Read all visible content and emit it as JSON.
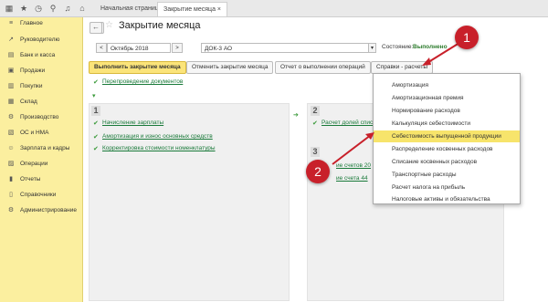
{
  "topbar": {
    "tabs": [
      "Начальная страница",
      "Закрытие месяца"
    ],
    "close_glyph": "×"
  },
  "sidebar": {
    "items": [
      {
        "label": "Главное",
        "icon": "menu-icon"
      },
      {
        "label": "Руководителю",
        "icon": "chart-icon"
      },
      {
        "label": "Банк и касса",
        "icon": "bank-icon"
      },
      {
        "label": "Продажи",
        "icon": "sales-icon"
      },
      {
        "label": "Покупки",
        "icon": "purchases-icon"
      },
      {
        "label": "Склад",
        "icon": "warehouse-icon"
      },
      {
        "label": "Производство",
        "icon": "production-icon"
      },
      {
        "label": "ОС и НМА",
        "icon": "assets-icon"
      },
      {
        "label": "Зарплата и кадры",
        "icon": "salary-icon"
      },
      {
        "label": "Операции",
        "icon": "operations-icon"
      },
      {
        "label": "Отчеты",
        "icon": "reports-icon"
      },
      {
        "label": "Справочники",
        "icon": "catalogs-icon"
      },
      {
        "label": "Администрирование",
        "icon": "admin-icon"
      }
    ]
  },
  "header": {
    "title": "Закрытие месяца"
  },
  "filters": {
    "period": "Октябрь 2018",
    "organization": "ДОК-3 АО",
    "state_label": "Состояние:",
    "state_value": "Выполнено"
  },
  "toolbar": {
    "run": "Выполнить закрытие месяца",
    "cancel": "Отменить закрытие месяца",
    "report": "Отчет о выполнении операций",
    "references": "Справки - расчеты"
  },
  "steps": {
    "pre_link": "Перепроведение документов",
    "step1_num": "1",
    "step1_items": [
      "Начисление зарплаты",
      "Амортизация и износ основных средств",
      "Корректировка стоимости номенклатуры"
    ],
    "step2_num": "2",
    "step2_item": "Расчет долей списа",
    "step3_num": "3",
    "step3_items": [
      "ие счетов 20",
      "ие счета 44"
    ]
  },
  "dropdown": {
    "items": [
      "Амортизация",
      "Амортизационная премия",
      "Нормирование расходов",
      "Калькуляция себестоимости",
      "Себестоимость выпущенной продукции",
      "Распределение косвенных расходов",
      "Списание косвенных расходов",
      "Транспортные расходы",
      "Расчет налога на прибыль",
      "Налоговые активы и обязательства"
    ],
    "highlighted_index": 4
  },
  "callouts": [
    "1",
    "2"
  ],
  "colors": {
    "sidebar_bg": "#fbef9f",
    "highlight": "#f7e46b",
    "callout": "#c8202a",
    "link": "#1a7a3a"
  }
}
